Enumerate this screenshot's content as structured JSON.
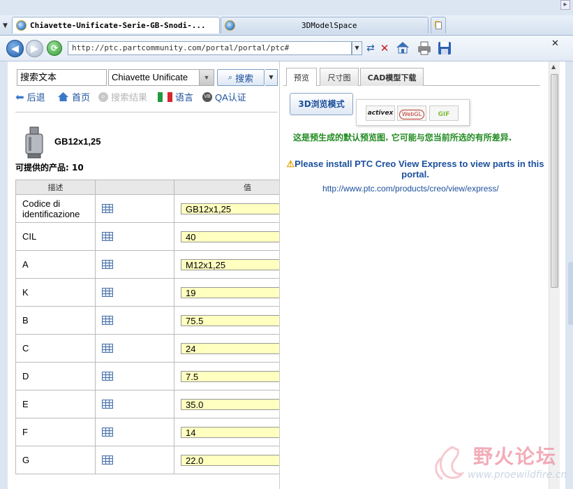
{
  "browser": {
    "tabs": [
      {
        "title": "Chiavette-Unificate-Serie-GB-Snodi-..."
      },
      {
        "title": "3DModelSpace"
      }
    ],
    "address": "http://ptc.partcommunity.com/portal/portal/ptc#"
  },
  "search": {
    "input_value": "搜索文本",
    "category_value": "Chiavette Unificate",
    "button_label": "搜索"
  },
  "nav": {
    "back": "后退",
    "home": "首页",
    "results": "搜索结果",
    "language": "语言",
    "qa": "QA认证"
  },
  "part": {
    "name": "GB12x1,25",
    "available_label": "可提供的产品: 10"
  },
  "table": {
    "headers": [
      "描述",
      "",
      "值"
    ],
    "rows": [
      {
        "label": "Codice di identificazione",
        "value": "GB12x1,25"
      },
      {
        "label": "CIL",
        "value": "40"
      },
      {
        "label": "A",
        "value": "M12x1,25"
      },
      {
        "label": "K",
        "value": "19"
      },
      {
        "label": "B",
        "value": "75.5"
      },
      {
        "label": "C",
        "value": "24"
      },
      {
        "label": "D",
        "value": "7.5"
      },
      {
        "label": "E",
        "value": "35.0"
      },
      {
        "label": "F",
        "value": "14"
      },
      {
        "label": "G",
        "value": "22.0"
      }
    ]
  },
  "preview": {
    "tabs": [
      "预览",
      "尺寸图",
      "CAD模型下载"
    ],
    "mode_button": "3D浏览模式",
    "formats": [
      "activex",
      "WebGL",
      "GIF"
    ],
    "notice": "这是预生成的默认预览图. 它可能与您当前所选的有所差异.",
    "install_msg": "Please install PTC Creo View Express to view parts in this portal.",
    "install_link": "http://www.ptc.com/products/creo/view/express/"
  },
  "watermark": {
    "text": "野火论坛",
    "url": "www.proewildfire.cn"
  },
  "colors": {
    "link": "#1b4f9c",
    "notice_green": "#228b22",
    "value_bg": "#ffffc0"
  }
}
